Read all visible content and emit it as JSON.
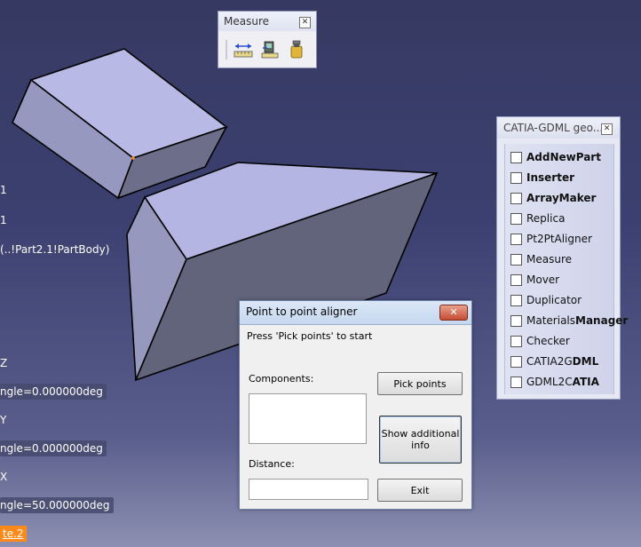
{
  "tree": {
    "lines": [
      "1",
      "1",
      "(..!Part2.1!PartBody)"
    ],
    "axis_z": "Z",
    "angle_1": "ngle=0.000000deg",
    "axis_y": "Y",
    "angle_2": "ngle=0.000000deg",
    "axis_x": "X",
    "angle_3": "ngle=50.000000deg",
    "highlighted": "te.2"
  },
  "measure_toolbar": {
    "title": "Measure",
    "icons": [
      "measure-between-icon",
      "measure-item-icon",
      "measure-inertia-icon"
    ]
  },
  "palette": {
    "title": "CATIA-GDML geo...",
    "items": [
      {
        "pre": "",
        "bold": "AddNewPart",
        "post": ""
      },
      {
        "pre": "",
        "bold": "Inserter",
        "post": ""
      },
      {
        "pre": "",
        "bold": "ArrayMaker",
        "post": ""
      },
      {
        "pre": "Replica",
        "bold": "",
        "post": ""
      },
      {
        "pre": "Pt2PtAligner",
        "bold": "",
        "post": ""
      },
      {
        "pre": "Measure",
        "bold": "",
        "post": ""
      },
      {
        "pre": "Mover",
        "bold": "",
        "post": ""
      },
      {
        "pre": "Duplicator",
        "bold": "",
        "post": ""
      },
      {
        "pre": "Materials",
        "bold": "Manager",
        "post": ""
      },
      {
        "pre": "Checker",
        "bold": "",
        "post": ""
      },
      {
        "pre": "CATIA2G",
        "bold": "DML",
        "post": ""
      },
      {
        "pre": "GDML2C",
        "bold": "ATIA",
        "post": ""
      }
    ]
  },
  "dialog": {
    "title": "Point to point aligner",
    "close": "✕",
    "instruction": "Press 'Pick points' to start",
    "components_label": "Components:",
    "distance_label": "Distance:",
    "distance_value": "",
    "pick_button": "Pick points",
    "show_info_line1": "Show additional",
    "show_info_line2": "info",
    "exit_button": "Exit"
  },
  "colors": {
    "background_top": "#363a62",
    "background_bottom": "#8d90b2",
    "face_top": "#b8b9e4",
    "face_side": "#8e90b6",
    "face_front": "#64667e",
    "highlight": "#ff8a1a"
  }
}
